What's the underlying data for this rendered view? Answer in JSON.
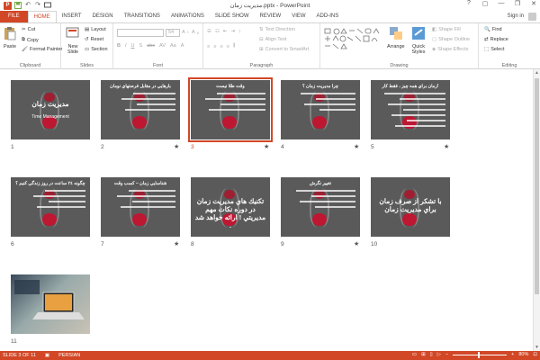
{
  "window": {
    "title": "مديريت زمان.pptx - PowerPoint",
    "app_logo": "P",
    "controls": [
      "?",
      "▢",
      "—",
      "❐",
      "✕"
    ]
  },
  "qat": {
    "save": "save-icon",
    "undo": "undo-icon",
    "redo": "redo-icon",
    "present": "present-icon"
  },
  "tabs": [
    "FILE",
    "HOME",
    "INSERT",
    "DESIGN",
    "TRANSITIONS",
    "ANIMATIONS",
    "SLIDE SHOW",
    "REVIEW",
    "VIEW",
    "ADD-INS"
  ],
  "sign_in": "Sign in",
  "ribbon": {
    "clipboard": {
      "label": "Clipboard",
      "paste": "Paste",
      "cut": "Cut",
      "copy": "Copy",
      "format_painter": "Format Painter"
    },
    "slides": {
      "label": "Slides",
      "new_slide": "New Slide",
      "layout": "Layout",
      "reset": "Reset",
      "section": "Section"
    },
    "font": {
      "label": "Font",
      "font_name": "",
      "font_size": "54"
    },
    "paragraph": {
      "label": "Paragraph",
      "text_direction": "Text Direction",
      "align_text": "Align Text",
      "smartart": "Convert to SmartArt"
    },
    "drawing": {
      "label": "Drawing",
      "arrange": "Arrange",
      "quick_styles": "Quick Styles",
      "shape_fill": "Shape Fill",
      "shape_outline": "Shape Outline",
      "shape_effects": "Shape Effects"
    },
    "editing": {
      "label": "Editing",
      "find": "Find",
      "replace": "Replace",
      "select": "Select"
    }
  },
  "slides": [
    {
      "num": "1",
      "title": "مديريت زمان",
      "sub": "Time Management",
      "star": false,
      "selected": false
    },
    {
      "num": "2",
      "title": "بارهايي در مقابل فرصتهاي نومان",
      "sub": "",
      "star": true,
      "selected": false
    },
    {
      "num": "3",
      "title": "وقت طلا نيست",
      "sub": "",
      "star": true,
      "selected": true
    },
    {
      "num": "4",
      "title": "چرا مديريت زمان ؟",
      "sub": "",
      "star": true,
      "selected": false
    },
    {
      "num": "5",
      "title": "زمان براي همه چيز ، فقط كار!",
      "sub": "",
      "star": true,
      "selected": false
    },
    {
      "num": "6",
      "title": "چگونه ٢٤ ساعت در روز زندگي كنيم ؟",
      "sub": "",
      "star": false,
      "selected": false
    },
    {
      "num": "7",
      "title": "شناسايي زمان – كسب وقت",
      "sub": "",
      "star": true,
      "selected": false
    },
    {
      "num": "8",
      "title": "تكنيك هاي مديريت زمان در دوره نكات مهم مديريتي ! ارائه خواهد شد .",
      "sub": "",
      "star": false,
      "selected": false
    },
    {
      "num": "9",
      "title": "تغيير نگرش",
      "sub": "",
      "star": true,
      "selected": false
    },
    {
      "num": "10",
      "title": "با تشكر از صرف زمان براي مديريت زمان",
      "sub": "",
      "star": false,
      "selected": false
    },
    {
      "num": "11",
      "title": "",
      "sub": "",
      "star": false,
      "selected": false
    }
  ],
  "status": {
    "slide_info": "SLIDE 3 OF 11",
    "language": "PERSIAN",
    "zoom": "80%",
    "zoom_minus": "−",
    "zoom_plus": "+"
  },
  "colors": {
    "accent": "#d24726",
    "slide_bg": "#5a5a5a",
    "sand": "#c8102e"
  }
}
